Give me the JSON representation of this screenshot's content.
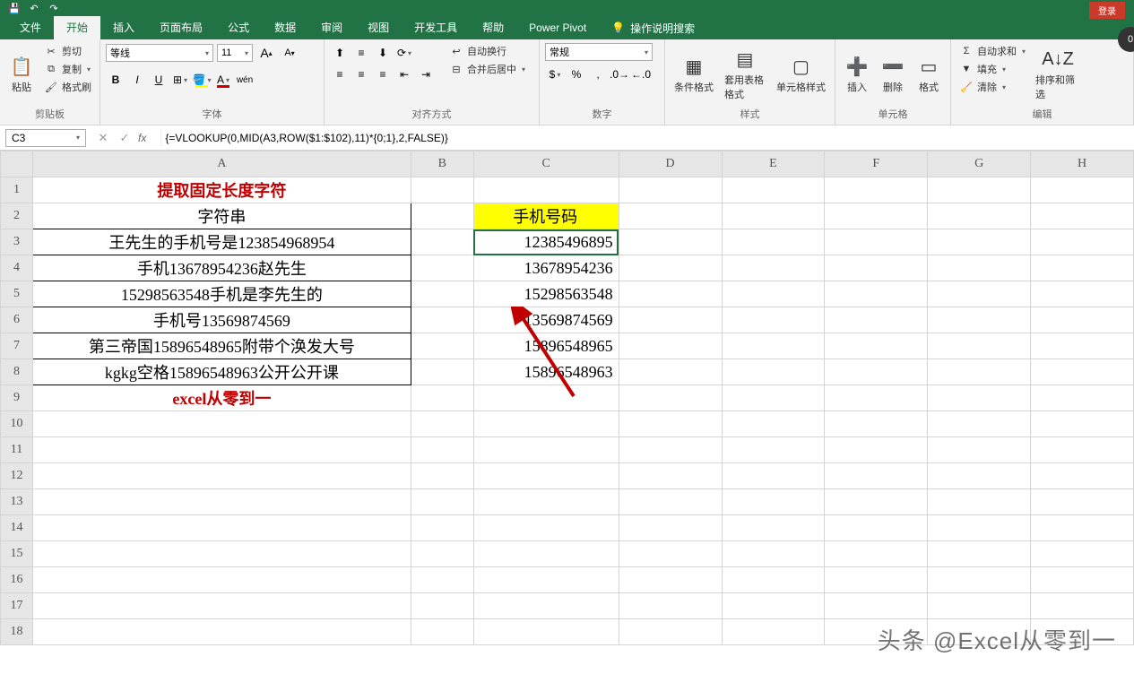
{
  "qat": {
    "save": "💾",
    "undo": "↶",
    "redo": "↷"
  },
  "login_label": "登录",
  "tabs": [
    "文件",
    "开始",
    "插入",
    "页面布局",
    "公式",
    "数据",
    "审阅",
    "视图",
    "开发工具",
    "帮助",
    "Power Pivot"
  ],
  "active_tab": "开始",
  "tell_me": "操作说明搜索",
  "clipboard": {
    "paste": "粘贴",
    "cut": "剪切",
    "copy": "复制",
    "format_painter": "格式刷",
    "label": "剪贴板"
  },
  "font": {
    "name": "等线",
    "size": "11",
    "grow": "A",
    "shrink": "A",
    "bold": "B",
    "italic": "I",
    "underline": "U",
    "wen": "wén",
    "label": "字体"
  },
  "align": {
    "wrap": "自动换行",
    "merge": "合并后居中",
    "label": "对齐方式"
  },
  "number": {
    "format": "常规",
    "label": "数字"
  },
  "styles": {
    "cond": "条件格式",
    "table": "套用表格格式",
    "cell": "单元格样式",
    "label": "样式"
  },
  "cells": {
    "insert": "插入",
    "delete": "删除",
    "format": "格式",
    "label": "单元格"
  },
  "editing": {
    "sum": "自动求和",
    "fill": "填充",
    "clear": "清除",
    "sort": "排序和筛选",
    "label": "编辑"
  },
  "name_box": "C3",
  "formula": "{=VLOOKUP(0,MID(A3,ROW($1:$102),11)*{0;1},2,FALSE)}",
  "columns": [
    "A",
    "B",
    "C",
    "D",
    "E",
    "F",
    "G",
    "H"
  ],
  "rows": [
    {
      "n": 1,
      "A": "提取固定长度字符",
      "A_class": "red center",
      "merge": 0
    },
    {
      "n": 2,
      "A": "字符串",
      "C": "手机号码",
      "C_class": "yellow-bg center",
      "A_class": "center data-border"
    },
    {
      "n": 3,
      "A": "王先生的手机号是123854968954",
      "C": "12385496895",
      "A_class": "center data-border",
      "C_class": "center active-cell"
    },
    {
      "n": 4,
      "A": "手机13678954236赵先生",
      "C": "13678954236",
      "A_class": "center data-border",
      "C_class": "center"
    },
    {
      "n": 5,
      "A": "15298563548手机是李先生的",
      "C": "15298563548",
      "A_class": "center data-border",
      "C_class": "center"
    },
    {
      "n": 6,
      "A": "手机号13569874569",
      "C": "13569874569",
      "A_class": "center data-border",
      "C_class": "center"
    },
    {
      "n": 7,
      "A": "第三帝国15896548965附带个涣发大号",
      "C": "15896548965",
      "A_class": "center data-border",
      "C_class": "center"
    },
    {
      "n": 8,
      "A": "kgkg空格15896548963公开公开课",
      "C": "15896548963",
      "A_class": "center data-border",
      "C_class": "center"
    },
    {
      "n": 9,
      "A": "excel从零到一",
      "A_class": "red center"
    },
    {
      "n": 10
    },
    {
      "n": 11
    },
    {
      "n": 12
    },
    {
      "n": 13
    },
    {
      "n": 14
    },
    {
      "n": 15
    },
    {
      "n": 16
    },
    {
      "n": 17
    },
    {
      "n": 18
    }
  ],
  "watermark": "头条 @Excel从零到一"
}
